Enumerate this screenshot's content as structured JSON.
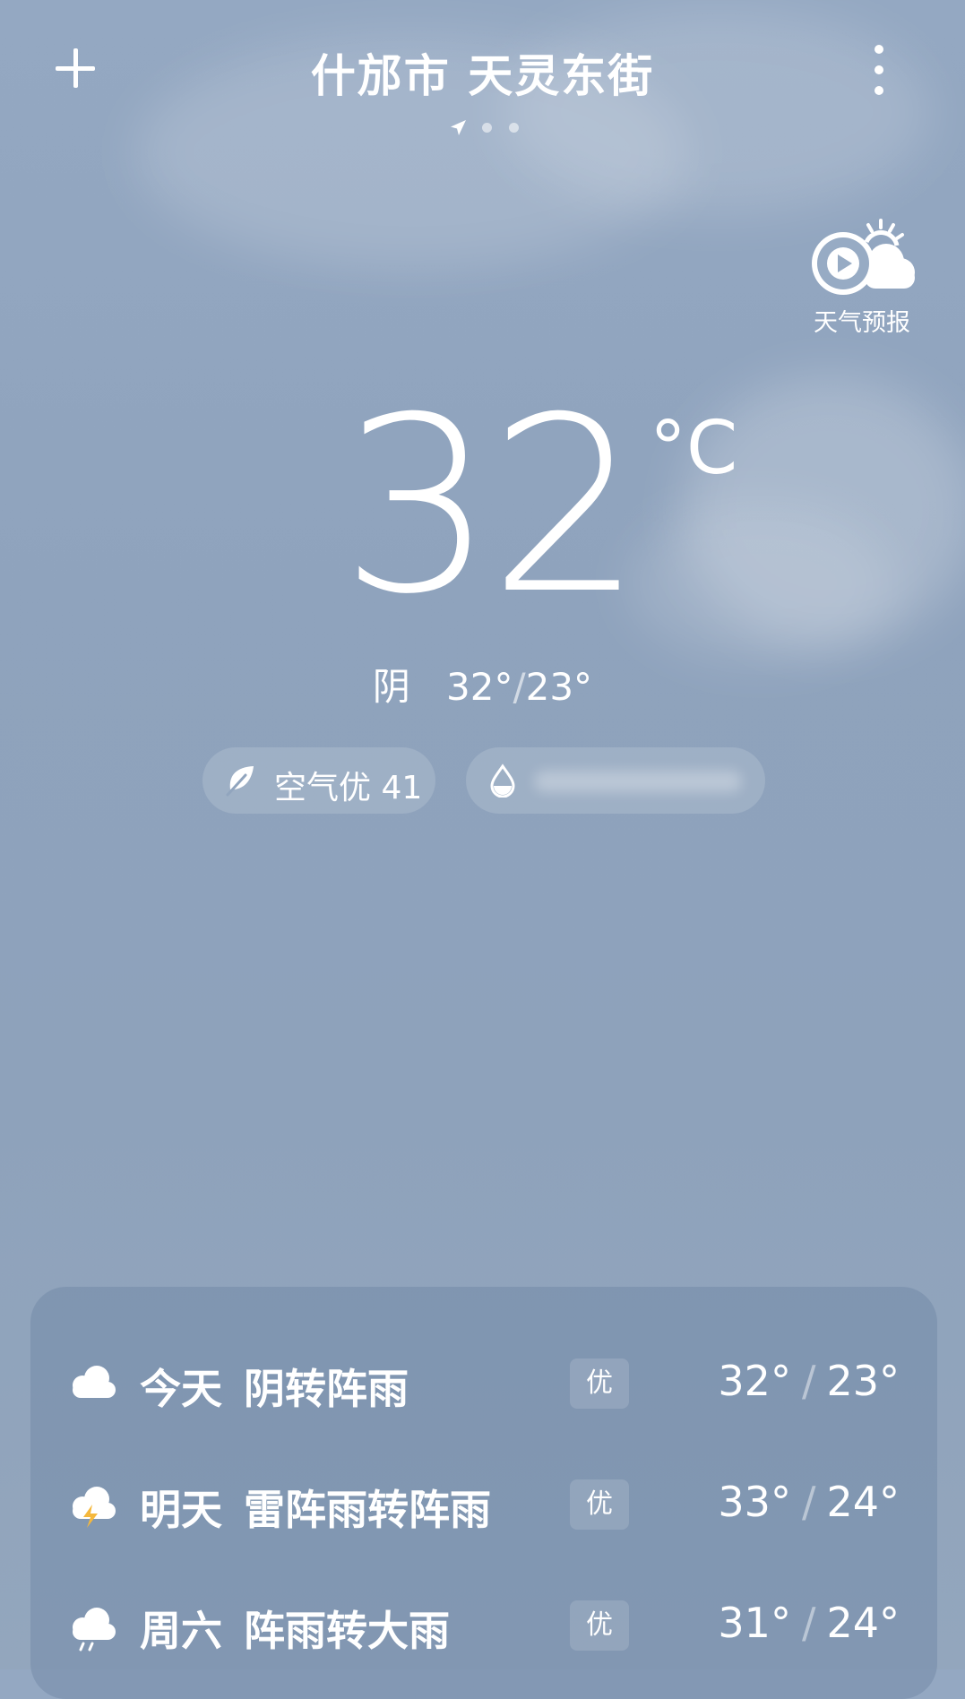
{
  "header": {
    "location_title": "什邡市 天灵东街",
    "page_indicator": {
      "current": 1,
      "total": 3
    }
  },
  "forecast_video": {
    "label": "天气预报",
    "icon": "play-cloud-sun-icon"
  },
  "current": {
    "temperature": "32",
    "unit": "°C",
    "condition": "阴",
    "high": "32°",
    "low": "23°",
    "separator": "/"
  },
  "pills": {
    "air_quality": {
      "text": "空气优 41",
      "icon": "leaf-icon"
    },
    "rain": {
      "text": "",
      "icon": "water-drop-icon"
    }
  },
  "daily_forecast": [
    {
      "day": "今天",
      "condition": "阴转阵雨",
      "aqi": "优",
      "high": "32°",
      "low": "23°",
      "icon": "cloud-icon"
    },
    {
      "day": "明天",
      "condition": "雷阵雨转阵雨",
      "aqi": "优",
      "high": "33°",
      "low": "24°",
      "icon": "thunderstorm-icon"
    },
    {
      "day": "周六",
      "condition": "阵雨转大雨",
      "aqi": "优",
      "high": "31°",
      "low": "24°",
      "icon": "rain-cloud-icon"
    }
  ],
  "colors": {
    "background": "#8fa3bd",
    "text": "#ffffff",
    "lightning": "#f5b83d"
  }
}
